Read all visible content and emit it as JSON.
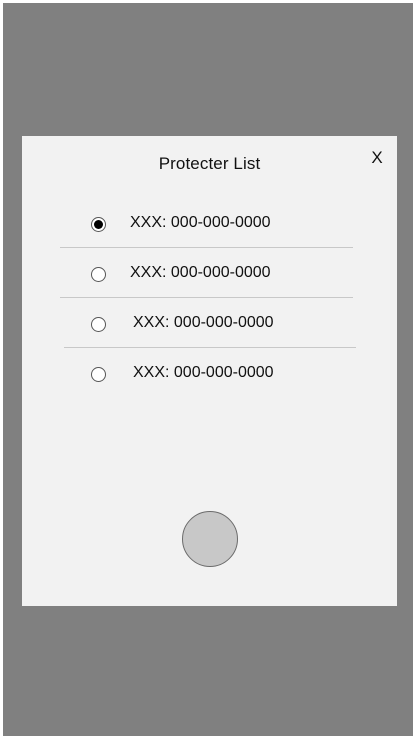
{
  "dialog": {
    "title": "Protecter List",
    "close_label": "X"
  },
  "protectors": [
    {
      "label": "XXX: 000-000-0000",
      "selected": true
    },
    {
      "label": "XXX: 000-000-0000",
      "selected": false
    },
    {
      "label": "XXX: 000-000-0000",
      "selected": false
    },
    {
      "label": "XXX: 000-000-0000",
      "selected": false
    }
  ],
  "colors": {
    "backdrop": "#808080",
    "dialog": "#f2f2f2",
    "action_button": "#c8c8c8"
  }
}
